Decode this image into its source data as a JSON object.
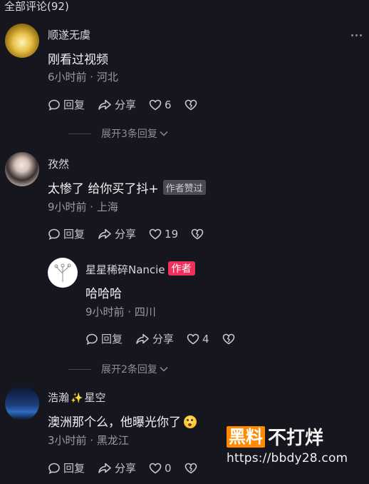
{
  "header": {
    "title": "全部评论(92)"
  },
  "comments": [
    {
      "name": "顺遂无虞",
      "text": "刚看过视频",
      "meta": "6小时前 · 河北",
      "reply_label": "回复",
      "share_label": "分享",
      "likes": "6",
      "expand": "展开3条回复"
    },
    {
      "name": "孜然",
      "text": "太惨了 给你买了抖+",
      "badge": "作者赞过",
      "meta": "9小时前 · 上海",
      "reply_label": "回复",
      "share_label": "分享",
      "likes": "19",
      "reply": {
        "name": "星星稀碎Nancie",
        "badge": "作者",
        "text": "哈哈哈",
        "meta": "9小时前 · 四川",
        "reply_label": "回复",
        "share_label": "分享",
        "likes": "4"
      },
      "expand": "展开2条回复"
    },
    {
      "name_part1": "浩瀚",
      "name_part2": "星空",
      "text": "澳洲那个么，他曝光你了",
      "meta": "3小时前 · 黑龙江",
      "reply_label": "回复",
      "share_label": "分享",
      "likes": "0"
    }
  ],
  "watermark": {
    "box": "黑料",
    "rest": "不打烊",
    "url": "https://bbdy28.com"
  },
  "colors": {
    "background": "#16161e",
    "author_badge": "#f0305a",
    "watermark_orange": "#ff8a00"
  }
}
